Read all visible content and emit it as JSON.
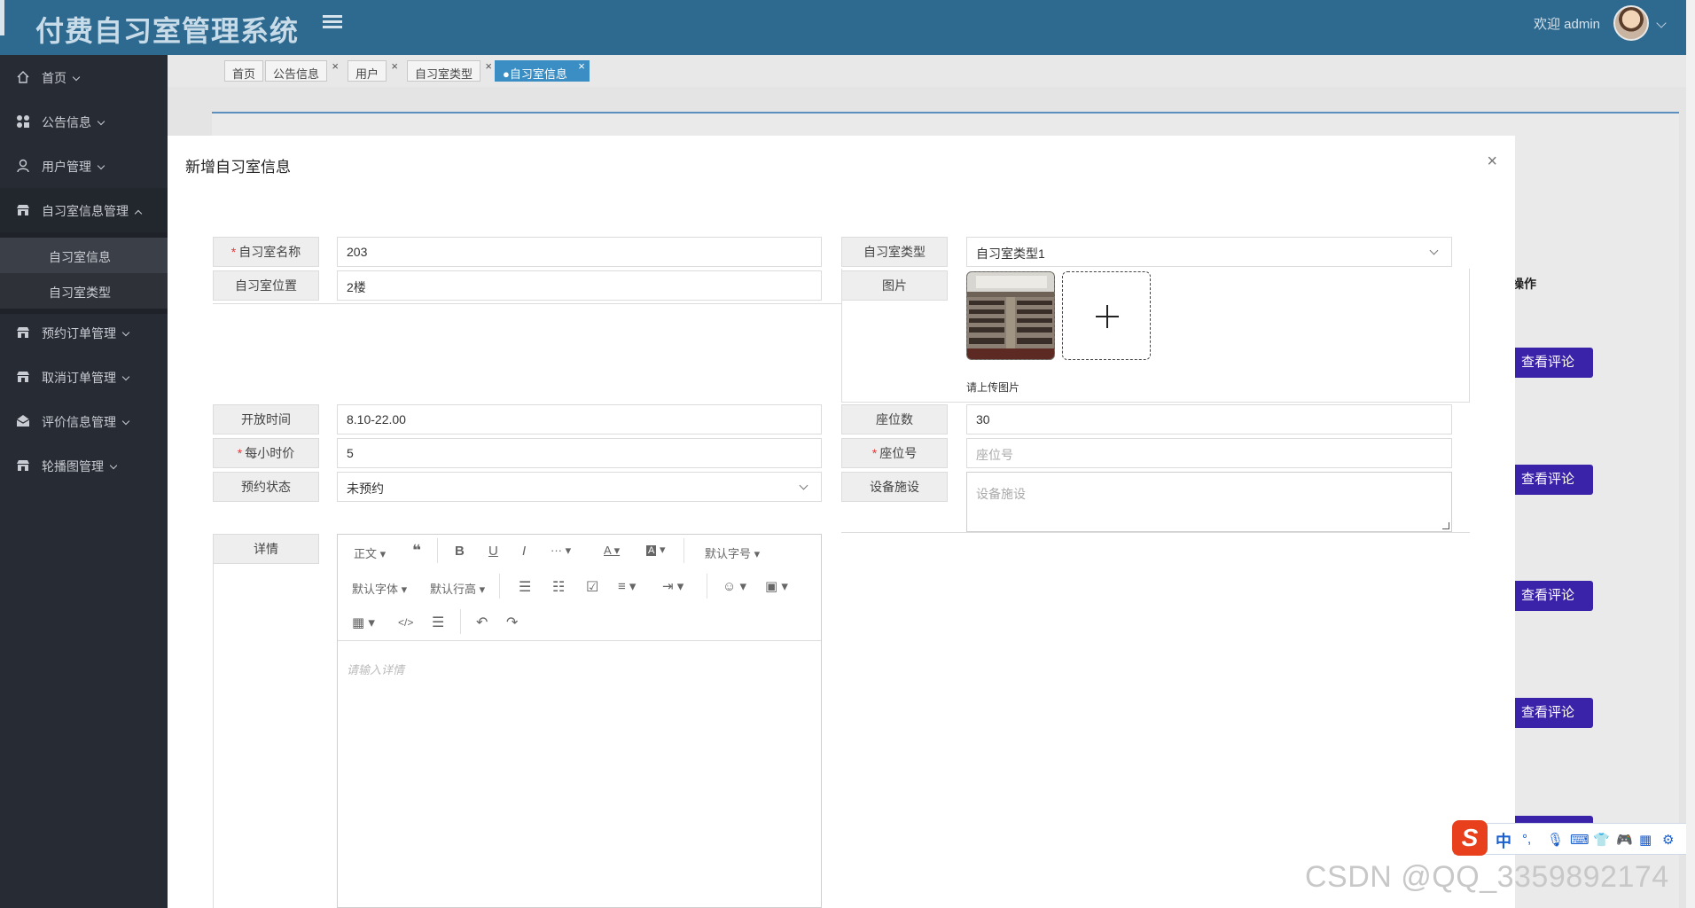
{
  "app": {
    "title": "付费自习室管理系统",
    "welcome": "欢迎 admin"
  },
  "sidebar": {
    "items": [
      {
        "label": "首页",
        "icon": "home-icon"
      },
      {
        "label": "公告信息",
        "icon": "apps-icon"
      },
      {
        "label": "用户管理",
        "icon": "user-icon"
      },
      {
        "label": "自习室信息管理",
        "icon": "store-icon"
      },
      {
        "label": "预约订单管理",
        "icon": "store-icon"
      },
      {
        "label": "取消订单管理",
        "icon": "store-icon"
      },
      {
        "label": "评价信息管理",
        "icon": "mail-icon"
      },
      {
        "label": "轮播图管理",
        "icon": "store-icon"
      }
    ],
    "sub": [
      {
        "label": "自习室信息"
      },
      {
        "label": "自习室类型"
      }
    ]
  },
  "tabs": [
    {
      "label": "首页"
    },
    {
      "label": "公告信息"
    },
    {
      "label": "用户"
    },
    {
      "label": "自习室类型"
    },
    {
      "label": "●自习室信息"
    }
  ],
  "background": {
    "op_header": "操作",
    "view_label": "查看评论"
  },
  "modal": {
    "title": "新增自习室信息",
    "close": "×",
    "fields": {
      "name": {
        "label": "自习室名称",
        "value": "203"
      },
      "type": {
        "label": "自习室类型",
        "value": "自习室类型1"
      },
      "location": {
        "label": "自习室位置",
        "value": "2楼"
      },
      "image": {
        "label": "图片",
        "hint": "请上传图片"
      },
      "open_time": {
        "label": "开放时间",
        "value": "8.10-22.00"
      },
      "seats": {
        "label": "座位数",
        "value": "30"
      },
      "price": {
        "label": "每小时价",
        "value": "5"
      },
      "seat_no": {
        "label": "座位号",
        "placeholder": "座位号"
      },
      "status": {
        "label": "预约状态",
        "value": "未预约"
      },
      "facilities": {
        "label": "设备施设",
        "placeholder": "设备施设"
      },
      "detail": {
        "label": "详情",
        "placeholder": "请输入详情"
      }
    },
    "toolbar": {
      "paragraph": "正文",
      "font_size": "默认字号",
      "font_family": "默认字体",
      "line_height": "默认行高"
    }
  },
  "ime": {
    "label": "中"
  },
  "watermark": "CSDN @QQ_3359892174"
}
